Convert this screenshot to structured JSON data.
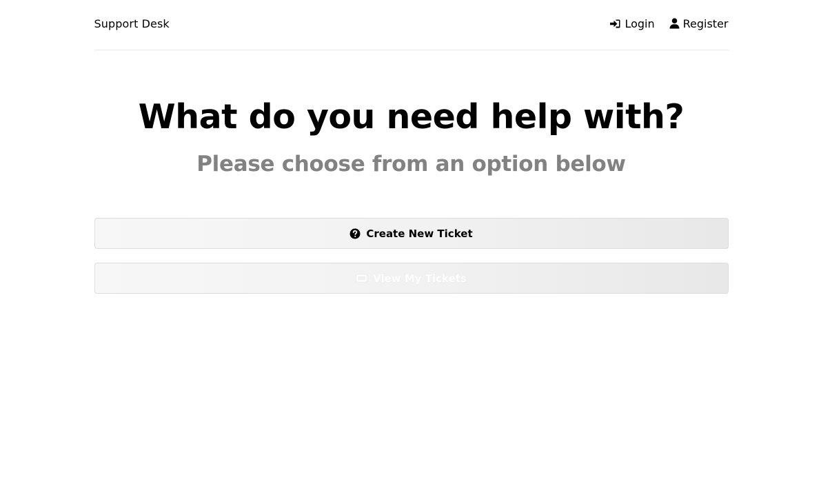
{
  "header": {
    "logo": "Support Desk",
    "nav": {
      "login_label": "Login",
      "register_label": "Register",
      "login_icon": "sign-in-icon",
      "register_icon": "user-icon"
    }
  },
  "hero": {
    "title": "What do you need help with?",
    "subtitle": "Please choose from an option below"
  },
  "actions": {
    "create_ticket_label": "Create New Ticket",
    "create_ticket_icon": "question-circle-icon",
    "view_tickets_label": "View My Tickets",
    "view_tickets_icon": "ticket-icon"
  },
  "colors": {
    "subtitle": "#828282",
    "divider": "#e6e6e6",
    "button_border": "#dcdcdc"
  }
}
